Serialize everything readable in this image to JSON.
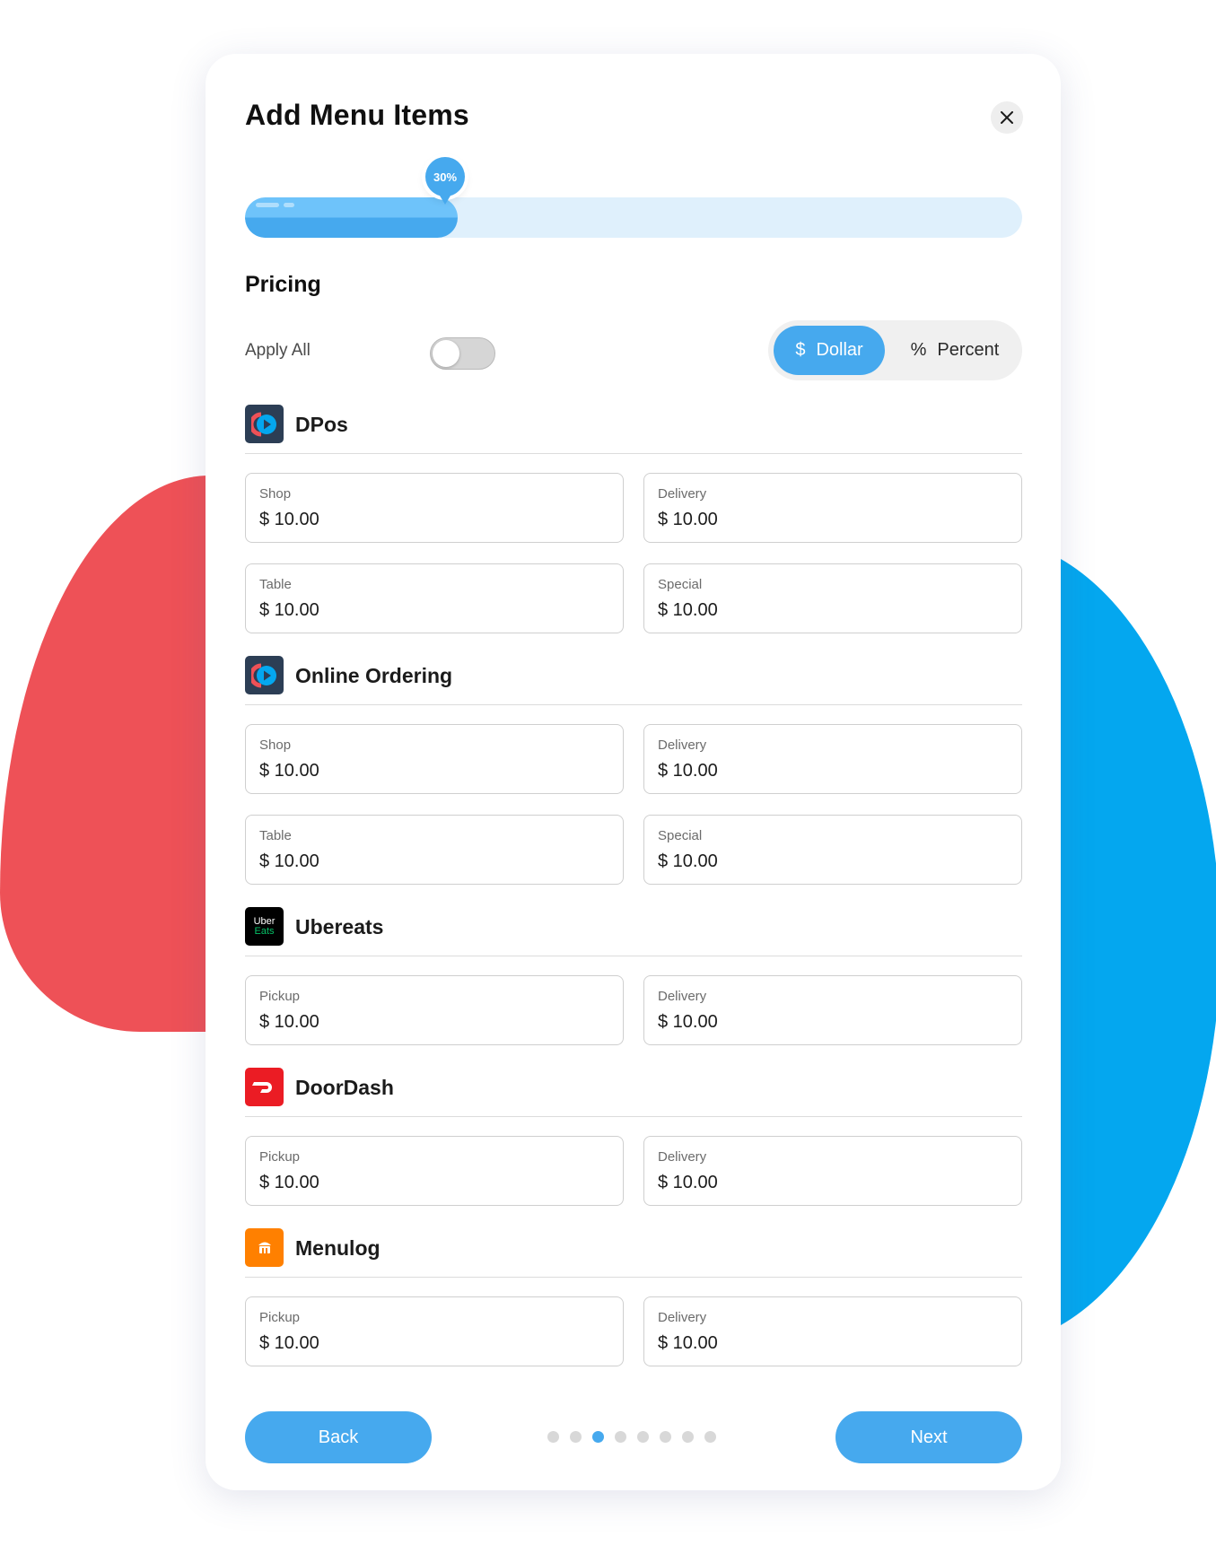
{
  "dialog": {
    "title": "Add Menu Items"
  },
  "progress": {
    "value_percent": 30,
    "label": "30%"
  },
  "pricing": {
    "title": "Pricing",
    "apply_all_label": "Apply All",
    "apply_all_on": false,
    "modes": [
      {
        "icon_text": "$",
        "label": "Dollar",
        "selected": true
      },
      {
        "icon_text": "%",
        "label": "Percent",
        "selected": false
      }
    ]
  },
  "platforms": [
    {
      "name": "DPos",
      "logo": "dpos-logo",
      "fields": [
        {
          "label": "Shop",
          "value": "$ 10.00"
        },
        {
          "label": "Delivery",
          "value": "$ 10.00"
        },
        {
          "label": "Table",
          "value": "$ 10.00"
        },
        {
          "label": "Special",
          "value": "$ 10.00"
        }
      ]
    },
    {
      "name": "Online Ordering",
      "logo": "dpos-logo",
      "fields": [
        {
          "label": "Shop",
          "value": "$ 10.00"
        },
        {
          "label": "Delivery",
          "value": "$ 10.00"
        },
        {
          "label": "Table",
          "value": "$ 10.00"
        },
        {
          "label": "Special",
          "value": "$ 10.00"
        }
      ]
    },
    {
      "name": "Ubereats",
      "logo": "ubereats-logo",
      "logo_text": [
        "Uber",
        "Eats"
      ],
      "fields": [
        {
          "label": "Pickup",
          "value": "$ 10.00"
        },
        {
          "label": "Delivery",
          "value": "$ 10.00"
        }
      ]
    },
    {
      "name": "DoorDash",
      "logo": "doordash-logo",
      "fields": [
        {
          "label": "Pickup",
          "value": "$ 10.00"
        },
        {
          "label": "Delivery",
          "value": "$ 10.00"
        }
      ]
    },
    {
      "name": "Menulog",
      "logo": "menulog-logo",
      "fields": [
        {
          "label": "Pickup",
          "value": "$ 10.00"
        },
        {
          "label": "Delivery",
          "value": "$ 10.00"
        }
      ]
    }
  ],
  "footer": {
    "back_label": "Back",
    "next_label": "Next",
    "steps_total": 8,
    "active_step": 3
  },
  "colors": {
    "accent": "#46a9ee",
    "blob_red": "#ee5157",
    "blob_blue": "#04a7ef",
    "dpos_bg": "#2c3e55",
    "ubereats_bg": "#000000",
    "doordash_bg": "#eb1c24",
    "menulog_bg": "#ff8000"
  }
}
